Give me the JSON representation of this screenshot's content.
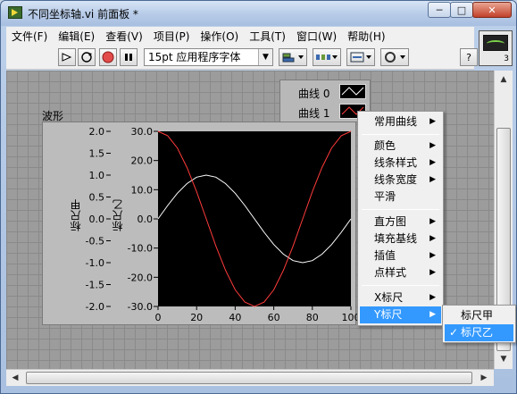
{
  "window": {
    "title": "不同坐标轴.vi 前面板 *",
    "controls": {
      "minimize": "─",
      "maximize": "□",
      "close": "✕"
    }
  },
  "menubar": [
    "文件(F)",
    "编辑(E)",
    "查看(V)",
    "项目(P)",
    "操作(O)",
    "工具(T)",
    "窗口(W)",
    "帮助(H)"
  ],
  "toolbar": {
    "font": "15pt 应用程序字体",
    "help": "?",
    "vi_icon_number": "3"
  },
  "graph": {
    "label": "波形",
    "y_axis_1_name": "标尺甲",
    "y_axis_2_name": "标尺乙",
    "y1_ticks": [
      "2.0",
      "1.5",
      "1.0",
      "0.5",
      "0.0",
      "-0.5",
      "-1.0",
      "-1.5",
      "-2.0"
    ],
    "y2_ticks": [
      "30.0",
      "20.0",
      "10.0",
      "0.0",
      "-10.0",
      "-20.0",
      "-30.0"
    ],
    "x_ticks": [
      "0",
      "20",
      "40",
      "60",
      "80",
      "100"
    ],
    "legend": [
      {
        "name": "曲线 0",
        "color": "#ffffff"
      },
      {
        "name": "曲线 1",
        "color": "#ff3b3b"
      }
    ]
  },
  "chart_data": {
    "type": "line",
    "x": [
      0,
      5,
      10,
      15,
      20,
      25,
      30,
      35,
      40,
      45,
      50,
      55,
      60,
      65,
      70,
      75,
      80,
      85,
      90,
      95,
      100
    ],
    "xlim": [
      0,
      100
    ],
    "ylim_left": [
      -2.0,
      2.0
    ],
    "ylim_right": [
      -30.0,
      30.0
    ],
    "ylabel_left": "标尺甲",
    "ylabel_right": "标尺乙",
    "background": "#000000",
    "series": [
      {
        "name": "曲线 0",
        "axis": "标尺乙",
        "color": "#ffffff",
        "values": [
          0.0,
          4.6,
          8.8,
          12.1,
          14.3,
          15.0,
          14.3,
          12.1,
          8.8,
          4.6,
          0.0,
          -4.6,
          -8.8,
          -12.1,
          -14.3,
          -15.0,
          -14.3,
          -12.1,
          -8.8,
          -4.6,
          0.0
        ]
      },
      {
        "name": "曲线 1",
        "axis": "标尺乙",
        "color": "#ff3b3b",
        "values": [
          30.0,
          28.5,
          24.3,
          17.6,
          9.3,
          0.0,
          -9.3,
          -17.6,
          -24.3,
          -28.5,
          -30.0,
          -28.5,
          -24.3,
          -17.6,
          -9.3,
          0.0,
          9.3,
          17.6,
          24.3,
          28.5,
          30.0
        ]
      }
    ]
  },
  "context_menu": {
    "groups": [
      [
        {
          "label": "常用曲线",
          "submenu": true
        }
      ],
      [
        {
          "label": "颜色",
          "submenu": true
        },
        {
          "label": "线条样式",
          "submenu": true
        },
        {
          "label": "线条宽度",
          "submenu": true
        },
        {
          "label": "平滑",
          "submenu": false
        }
      ],
      [
        {
          "label": "直方图",
          "submenu": true
        },
        {
          "label": "填充基线",
          "submenu": true
        },
        {
          "label": "插值",
          "submenu": true
        },
        {
          "label": "点样式",
          "submenu": true
        }
      ],
      [
        {
          "label": "X标尺",
          "submenu": true
        },
        {
          "label": "Y标尺",
          "submenu": true,
          "active": true
        }
      ]
    ],
    "arrow": "▶"
  },
  "submenu": {
    "items": [
      {
        "label": "标尺甲",
        "checked": false
      },
      {
        "label": "标尺乙",
        "checked": true
      }
    ],
    "check": "✓"
  }
}
